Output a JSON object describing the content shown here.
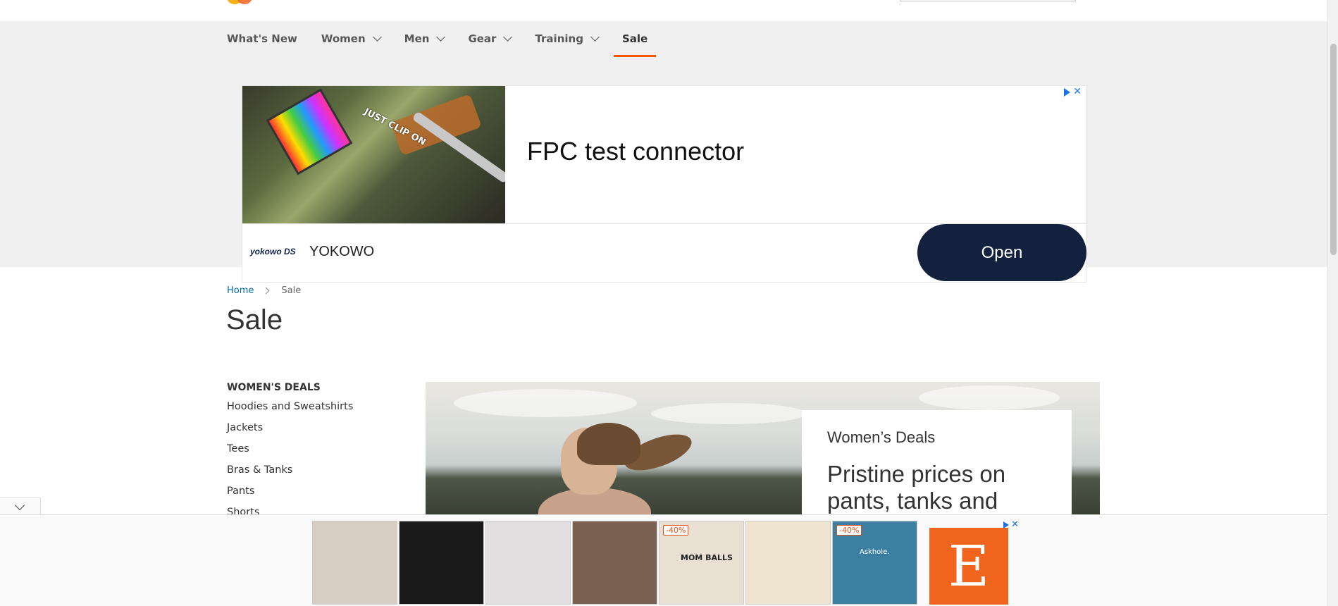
{
  "nav": {
    "items": [
      {
        "label": "What's New",
        "has_chevron": false
      },
      {
        "label": "Women",
        "has_chevron": true
      },
      {
        "label": "Men",
        "has_chevron": true
      },
      {
        "label": "Gear",
        "has_chevron": true
      },
      {
        "label": "Training",
        "has_chevron": true
      },
      {
        "label": "Sale",
        "has_chevron": false,
        "active": true
      }
    ]
  },
  "ad": {
    "image_text": "JUST CLIP ON",
    "title": "FPC test connector",
    "brand_logo": "yokowo DS",
    "brand": "YOKOWO",
    "cta": "Open",
    "close": "✕"
  },
  "breadcrumb": {
    "home": "Home",
    "current": "Sale"
  },
  "page": {
    "title": "Sale"
  },
  "sidebar": {
    "heading": "WOMEN'S DEALS",
    "links": [
      "Hoodies and Sweatshirts",
      "Jackets",
      "Tees",
      "Bras & Tanks",
      "Pants",
      "Shorts"
    ]
  },
  "hero": {
    "kicker": "Women’s Deals",
    "headline": "Pristine prices on pants, tanks and"
  },
  "bottom_ad": {
    "thumbs": [
      {
        "name": "leggings-thumb",
        "badge": "",
        "color": "#d8cfc4"
      },
      {
        "name": "pink-figure-thumb",
        "badge": "",
        "color": "#1a1a1a"
      },
      {
        "name": "bodysuit-thumb",
        "badge": "",
        "color": "#e2dfe0"
      },
      {
        "name": "woman-cat-thumb",
        "badge": "",
        "color": "#7a6050"
      },
      {
        "name": "sweatshirt-thumb",
        "badge": "-40%",
        "text": "MOM BALLS",
        "color": "#e9dfd2"
      },
      {
        "name": "cheesecake-thumb",
        "badge": "",
        "color": "#eee4d0"
      },
      {
        "name": "tshirt-thumb",
        "badge": "-40%",
        "text": "Askhole.",
        "color": "#3d7fa0"
      }
    ],
    "etsy_letter": "E",
    "close": "✕"
  }
}
